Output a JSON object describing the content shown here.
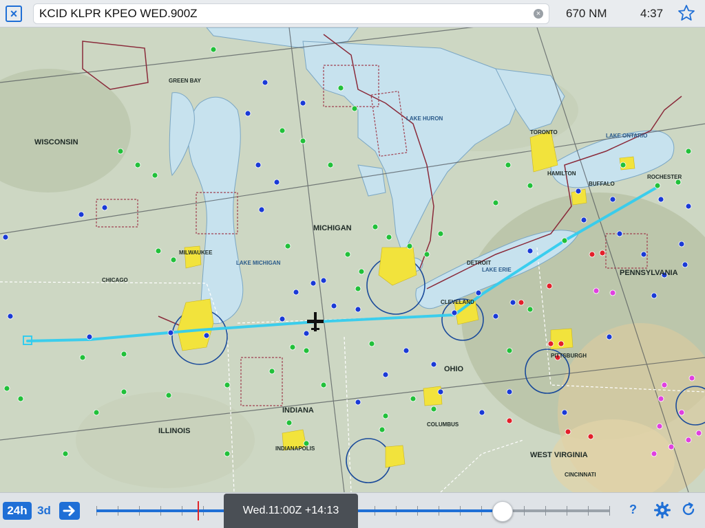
{
  "header": {
    "route": "KCID KLPR KPEO WED.900Z",
    "distance": "670 NM",
    "duration": "4:37",
    "close_icon": "close-x-icon",
    "clear_icon": "clear-circle-icon",
    "favorite_icon": "star-icon"
  },
  "map": {
    "regions": [
      "WISCONSIN",
      "MICHIGAN",
      "INDIANA",
      "ILLINOIS",
      "OHIO",
      "PENNSYLVANIA",
      "WEST VIRGINIA"
    ],
    "lakes": [
      "LAKE MICHIGAN",
      "LAKE HURON",
      "LAKE ERIE",
      "LAKE ONTARIO"
    ],
    "cities": [
      "MILWAUKEE",
      "CHICAGO",
      "DETROIT",
      "CLEVELAND",
      "TORONTO",
      "HAMILTON",
      "BUFFALO",
      "INDIANAPOLIS",
      "COLUMBUS",
      "CINCINNATI",
      "PITTSBURGH",
      "GREEN BAY",
      "ROCHESTER"
    ],
    "colors": {
      "route": "#33ccee",
      "vfr": "#22c03a",
      "mvfr": "#1a3ad6",
      "ifr": "#e3202a",
      "lifr": "#e040e0",
      "water": "#c7e2ee",
      "land": "#cfd8c6"
    }
  },
  "timeline": {
    "mode_24h": "24h",
    "mode_3d": "3d",
    "forward_icon": "arrow-right-icon",
    "time_label": "Wed.11:00Z +14:13",
    "progress": 0.79,
    "help": "?",
    "settings_icon": "gear-icon",
    "refresh_icon": "refresh-icon"
  }
}
